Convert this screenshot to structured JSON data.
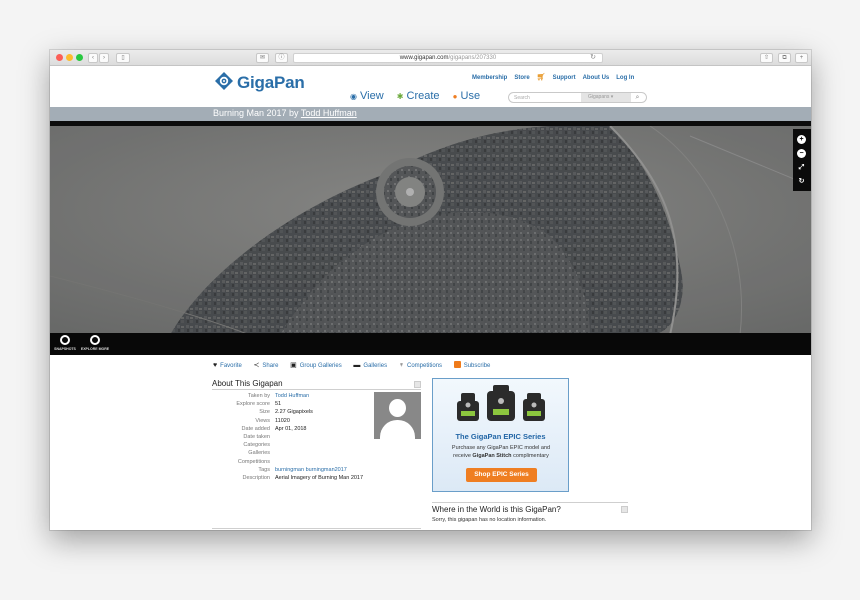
{
  "browser": {
    "url_host": "www.gigapan.com",
    "url_path": "/gigapans/207330"
  },
  "header": {
    "logo_text": "GigaPan",
    "top_nav": [
      "Membership",
      "Store",
      "Support",
      "About Us",
      "Log In"
    ],
    "main_nav": [
      {
        "label": "View",
        "icon": "eye-icon"
      },
      {
        "label": "Create",
        "icon": "gear-icon"
      },
      {
        "label": "Use",
        "icon": "lightbulb-icon"
      }
    ],
    "search_placeholder": "Search",
    "search_scope": "Gigapans"
  },
  "title": {
    "prefix": "Burning Man 2017 by ",
    "author": "Todd Huffman"
  },
  "viewer": {
    "snapshots_label": "SNAPSHOTS",
    "explore_label": "EXPLORE MORE"
  },
  "actions": [
    "Favorite",
    "Share",
    "Group Galleries",
    "Galleries",
    "Competitions",
    "Subscribe"
  ],
  "about": {
    "title": "About This Gigapan",
    "rows": [
      {
        "key": "Taken by",
        "value": "Todd Huffman",
        "link": true
      },
      {
        "key": "Explore score",
        "value": "51",
        "link": false
      },
      {
        "key": "Size",
        "value": "2.27 Gigapixels",
        "link": false
      },
      {
        "key": "Views",
        "value": "11020",
        "link": false
      },
      {
        "key": "Date added",
        "value": "Apr 01, 2018",
        "link": false
      },
      {
        "key": "Date taken",
        "value": "",
        "link": false
      },
      {
        "key": "Categories",
        "value": "",
        "link": false
      },
      {
        "key": "Galleries",
        "value": "",
        "link": false
      },
      {
        "key": "Competitions",
        "value": "",
        "link": false
      },
      {
        "key": "Tags",
        "value": "burningman burningman2017",
        "link": true
      },
      {
        "key": "Description",
        "value": "Aerial Imagery of Burning Man 2017",
        "link": false
      }
    ]
  },
  "ad": {
    "title": "The GigaPan EPIC Series",
    "body_line1": "Purchase any GigaPan EPIC model and",
    "body_prefix": "receive ",
    "body_bold": "GigaPan Stitch",
    "body_suffix": " complimentary",
    "button": "Shop EPIC Series"
  },
  "where": {
    "title": "Where in the World is this GigaPan?",
    "text": "Sorry, this gigapan has no location information."
  },
  "colors": {
    "link_blue": "#2a6ea8",
    "title_bar": "#a3adb6",
    "accent_orange": "#ef7e22"
  }
}
